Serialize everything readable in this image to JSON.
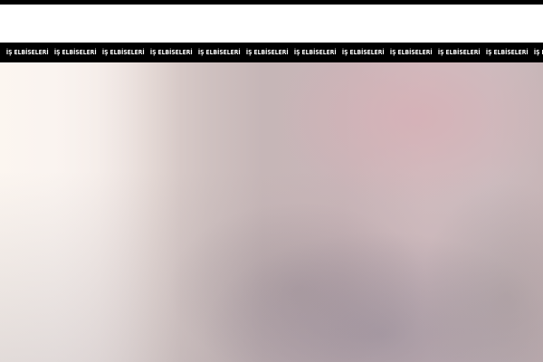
{
  "marquee": {
    "items": [
      "İŞ ELBİSELERİ",
      "İŞ ELBİSELERİ",
      "İŞ ELBİSELERİ",
      "İŞ ELBİSELERİ",
      "İŞ ELBİSELERİ",
      "İŞ ELBİSELERİ",
      "İŞ ELBİSELERİ",
      "İŞ ELBİSELERİ",
      "İŞ ELBİSELERİ",
      "İŞ ELBİSELERİ",
      "İŞ ELBİSELERİ",
      "İŞ ELBİSELERİ"
    ]
  },
  "colors": {
    "bar_background": "#000000",
    "bar_text": "#ffffff",
    "page_background": "#ffffff"
  }
}
